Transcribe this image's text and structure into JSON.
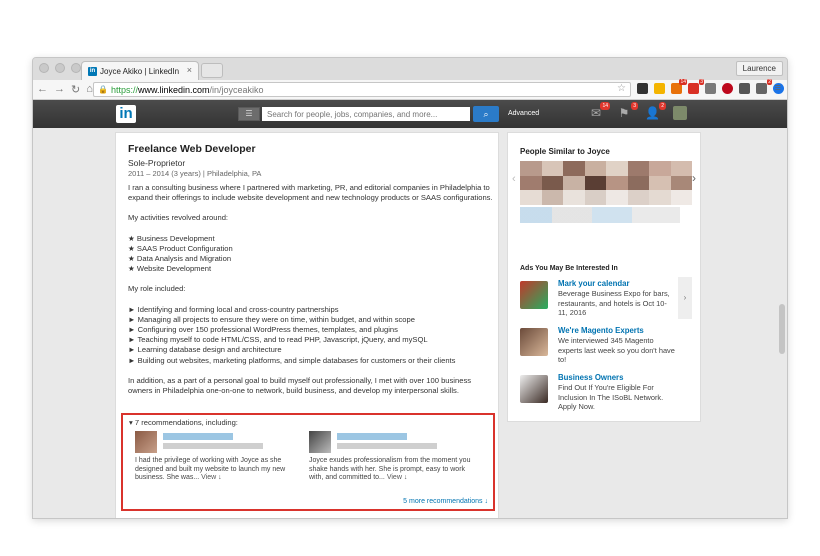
{
  "browser": {
    "tab_title": "Joyce Akiko | LinkedIn",
    "tab_favicon": "in",
    "tab_close": "×",
    "profile_name": "Laurence",
    "url_scheme": "https://",
    "url_host": "www.linkedin.com",
    "url_path": "/in/joyceakiko",
    "extension_badges": [
      "14",
      "3",
      "2"
    ]
  },
  "header": {
    "logo": "in",
    "search_placeholder": "Search for people, jobs, companies, and more...",
    "advanced_label": "Advanced",
    "badges": [
      "14",
      "3",
      "2"
    ]
  },
  "position": {
    "title": "Freelance Web Developer",
    "company": "Sole-Proprietor",
    "dates": "2011 – 2014 (3 years)  |  Philadelphia, PA",
    "intro": "I ran a consulting business where I partnered with marketing, PR, and editorial companies in Philadelphia to expand their offerings to include website development and new technology products or SAAS configurations.",
    "activities_intro": "My activities revolved around:",
    "activities": [
      "★ Business Development",
      "★ SAAS Product Configuration",
      "★ Data Analysis and Migration",
      "★ Website Development"
    ],
    "role_intro": "My role included:",
    "roles": [
      "► Identifying and forming local and cross-country partnerships",
      "► Managing all projects to ensure they were on time, within budget, and within scope",
      "► Configuring over 150 professional WordPress themes, templates, and plugins",
      "► Teaching myself to code HTML/CSS, and to read PHP, Javascript, jQuery, and mySQL",
      "► Learning database design and architecture",
      "► Building out websites, marketing platforms, and simple databases for customers or their clients"
    ],
    "closing": "In addition, as a part of a personal goal to build myself out professionally, I met with over 100 business owners in Philadelphia one-on-one to network, build business, and develop my interpersonal skills."
  },
  "recommendations": {
    "header": "▾ 7 recommendations, including:",
    "items": [
      {
        "text": "I had the privilege of working with Joyce as she designed and built my website to launch my new business. She was...",
        "view": "View ↓"
      },
      {
        "text": "Joyce exudes professionalism from the moment you shake hands with her. She is prompt, easy to work with, and committed to...",
        "view": "View ↓"
      }
    ],
    "more_link": "5 more recommendations ↓"
  },
  "sidebar": {
    "similar_heading": "People Similar to Joyce",
    "ads_heading": "Ads You May Be Interested In",
    "ads": [
      {
        "title": "Mark your calendar",
        "body": "Beverage Business Expo for bars, restaurants, and hotels is Oct 10-11, 2016"
      },
      {
        "title": "We're Magento Experts",
        "body": "We interviewed 345 Magento experts last week so you don't have to!"
      },
      {
        "title": "Business Owners",
        "body": "Find Out If You're Eligible For Inclusion In The ISoBL Network. Apply Now."
      }
    ],
    "ad_arrow": "›"
  },
  "colors": {
    "linkedin_blue": "#0077b5",
    "link_blue": "#0073b1",
    "highlight_red": "#d9332c"
  }
}
